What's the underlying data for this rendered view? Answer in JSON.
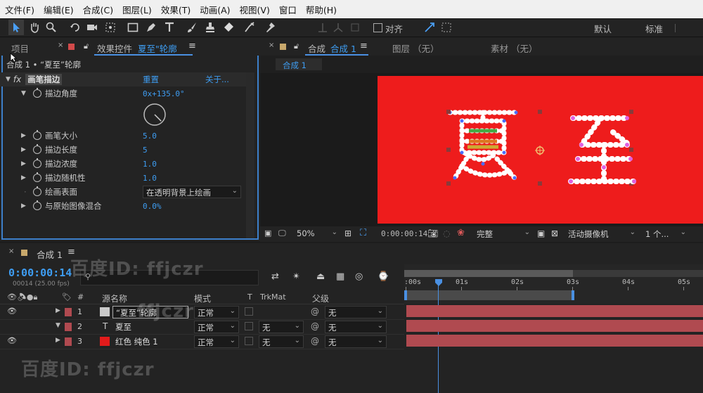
{
  "menu": [
    "文件(F)",
    "编辑(E)",
    "合成(C)",
    "图层(L)",
    "效果(T)",
    "动画(A)",
    "视图(V)",
    "窗口",
    "帮助(H)"
  ],
  "toolbar": {
    "tools": [
      "selection-tool",
      "hand-tool",
      "zoom-tool",
      "rotate-tool",
      "camera-tool",
      "pan-behind-tool",
      "rectangle-tool",
      "pen-tool",
      "type-tool",
      "brush-tool",
      "clone-stamp-tool",
      "eraser-tool",
      "roto-brush-tool",
      "puppet-tool"
    ],
    "align_label": "对齐",
    "workspaces": [
      "默认",
      "标准"
    ]
  },
  "project_tab": "项目",
  "effects_panel": {
    "tab_prefix": "效果控件",
    "tab_layer": "夏至\"轮廓",
    "breadcrumb": "合成 1 • “夏至”轮廓",
    "effect_name": "画笔描边",
    "reset_label": "重置",
    "about_label": "关于...",
    "properties": [
      {
        "label": "描边角度",
        "value": "0x+135.0°"
      },
      {
        "label": "画笔大小",
        "value": "5.0"
      },
      {
        "label": "描边长度",
        "value": "5"
      },
      {
        "label": "描边浓度",
        "value": "1.0"
      },
      {
        "label": "描边随机性",
        "value": "1.0"
      },
      {
        "label": "绘画表面",
        "value": "在透明背景上绘画"
      },
      {
        "label": "与原始图像混合",
        "value": "0.0%"
      }
    ],
    "angle_degrees": 135
  },
  "viewer_tabs": {
    "comp_prefix": "合成",
    "comp_name": "合成 1",
    "layer_tab": "图层 （无）",
    "footage_tab": "素材 （无）",
    "sub_tab": "合成 1"
  },
  "canvas": {
    "background": "#ee1c1c",
    "text_left": "夏",
    "text_right": "至"
  },
  "viewer_controls": {
    "zoom": "50%",
    "timecode": "0:00:00:14",
    "resolution": "完整",
    "camera": "活动摄像机",
    "views": "1 个..."
  },
  "timeline": {
    "tab": "合成 1",
    "timecode": "0:00:00:14",
    "frame_info": "00014 (25.00 fps)",
    "col_source": "源名称",
    "col_mode": "模式",
    "col_t": "T",
    "col_trkmat": "TrkMat",
    "col_parent": "父级",
    "col_hash": "#",
    "ruler": [
      ":00s",
      "01s",
      "02s",
      "03s",
      "04s",
      "05s"
    ],
    "layers": [
      {
        "num": "1",
        "name": "“夏至”轮廓",
        "mode": "正常",
        "trkmat": "",
        "parent": "无",
        "color": "#c9c9c9"
      },
      {
        "num": "2",
        "name": "夏至",
        "mode": "正常",
        "trkmat": "无",
        "parent": "无",
        "color": "#c9c9c9"
      },
      {
        "num": "3",
        "name": "红色 纯色 1",
        "mode": "正常",
        "trkmat": "无",
        "parent": "无",
        "color": "#e21b1b"
      }
    ]
  },
  "watermarks": [
    "百度ID: ffjczr",
    "ffjczr",
    "百度ID: ffjczr"
  ]
}
